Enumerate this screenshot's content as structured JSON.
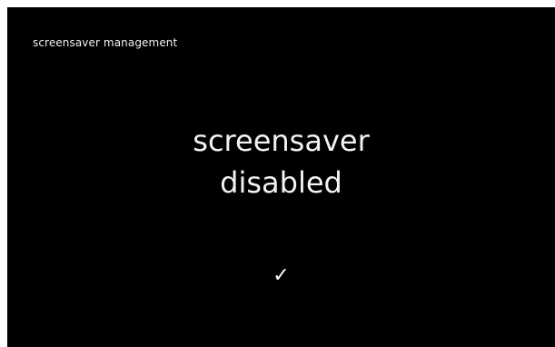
{
  "screen": {
    "title": "screensaver management",
    "message_line1": "screensaver",
    "message_line2": "disabled",
    "confirm_icon": "checkmark-icon",
    "confirm_glyph": "✓",
    "background_color": "#000000",
    "text_color": "#f2f2f2"
  }
}
